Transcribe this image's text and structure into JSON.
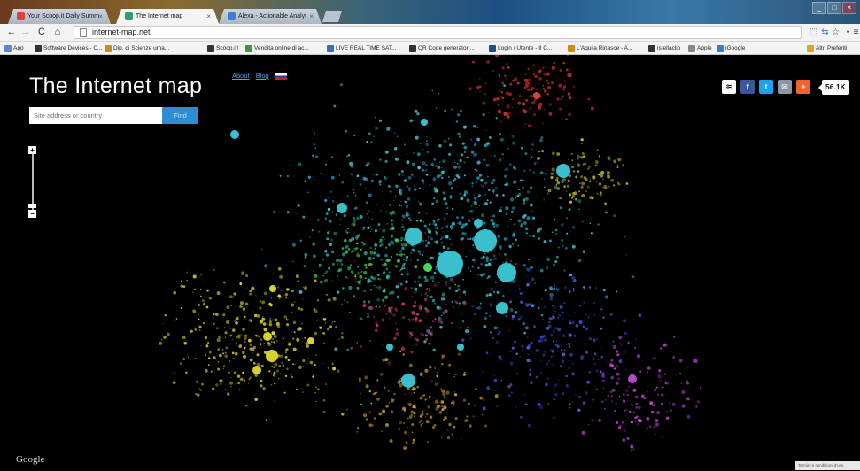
{
  "browser": {
    "tabs": [
      {
        "label": "Your Scoop.it Daily Summ",
        "active": false,
        "favicon_color": "#d9453b"
      },
      {
        "label": "The Internet map",
        "active": true,
        "favicon_color": "#2f9e6b"
      },
      {
        "label": "Alexa - Actionable Analyt",
        "active": false,
        "favicon_color": "#3d7bd6"
      }
    ],
    "url": "internet-map.net",
    "bookmarks": [
      {
        "label": "App",
        "color": "#5a87c6"
      },
      {
        "label": "Software Devices - C...",
        "color": "#333333"
      },
      {
        "label": "Dip. di Scienze uma...",
        "color": "#c98b1d"
      },
      {
        "label": "Scoop.it!",
        "color": "#333333"
      },
      {
        "label": "Vendita online di ac...",
        "color": "#3c9a3c"
      },
      {
        "label": "LIVE REAL TIME SAT...",
        "color": "#3d6fb0"
      },
      {
        "label": "QR Code generator ...",
        "color": "#333333"
      },
      {
        "label": "Login / Utente - Il C...",
        "color": "#1e4c8c"
      },
      {
        "label": "L'Aquila Rinasce - A...",
        "color": "#d08a18"
      },
      {
        "label": "istellaclip",
        "color": "#333333"
      },
      {
        "label": "Apple",
        "color": "#888888"
      },
      {
        "label": "iGoogle",
        "color": "#3d7bd6"
      }
    ],
    "other_bookmarks": "Altri Preferiti"
  },
  "page": {
    "title": "The Internet map",
    "links": {
      "about": "About",
      "blog": "Blog"
    },
    "search": {
      "placeholder": "Site address or country",
      "button": "Find"
    },
    "share_count": "56.1K",
    "google_logo": "Google",
    "terms": "Termini e condizioni d'uso"
  },
  "colors": {
    "accent": "#2b8ed4",
    "facebook": "#3b5998",
    "twitter": "#1da1f2",
    "email": "#8a97a6",
    "plus": "#f2622b"
  }
}
